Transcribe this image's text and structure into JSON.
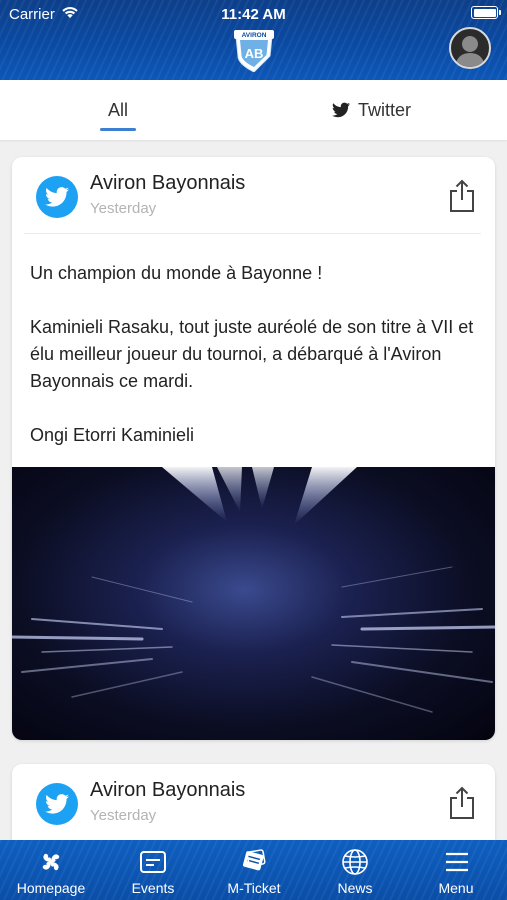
{
  "status_bar": {
    "carrier": "Carrier",
    "time": "11:42 AM"
  },
  "header": {
    "logo_icon": "aviron-bayonnais-logo",
    "logo_text": "AVIRON",
    "logo_letters": "AB",
    "profile_icon": "avatar-icon"
  },
  "tabs": [
    {
      "label": "All",
      "active": true
    },
    {
      "label": "Twitter",
      "icon": "twitter-icon",
      "active": false
    }
  ],
  "posts": [
    {
      "author": "Aviron Bayonnais",
      "time": "Yesterday",
      "source_icon": "twitter-icon",
      "paragraphs": [
        "Un champion du monde à Bayonne !",
        "Kaminieli Rasaku, tout juste auréolé de son titre à VII et élu meilleur joueur du tournoi, a débarqué à l'Aviron Bayonnais ce mardi.",
        "Ongi Etorri Kaminieli"
      ],
      "has_media": true
    },
    {
      "author": "Aviron Bayonnais",
      "time": "Yesterday",
      "source_icon": "twitter-icon"
    }
  ],
  "bottom_nav": [
    {
      "label": "Homepage",
      "icon": "lauburu-icon"
    },
    {
      "label": "Events",
      "icon": "events-icon"
    },
    {
      "label": "M-Ticket",
      "icon": "ticket-icon"
    },
    {
      "label": "News",
      "icon": "globe-icon"
    },
    {
      "label": "Menu",
      "icon": "hamburger-icon"
    }
  ],
  "colors": {
    "header_blue": "#0a4aa3",
    "accent": "#3c7fd0",
    "twitter": "#1da1f2"
  }
}
